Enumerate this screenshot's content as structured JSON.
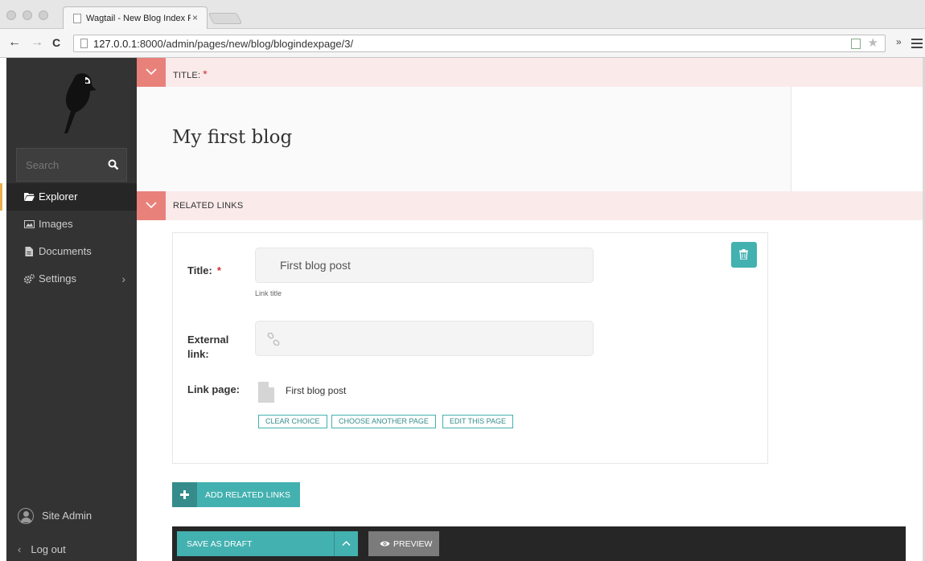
{
  "browser": {
    "tab_title": "Wagtail - New Blog Index P",
    "tab_close": "×",
    "url_host": "127.0.0.1",
    "url_rest": ":8000/admin/pages/new/blog/blogindexpage/3/",
    "back": "←",
    "forward": "→",
    "reload": "C",
    "star": "★",
    "chevrons": "»"
  },
  "sidebar": {
    "search_placeholder": "Search",
    "items": [
      {
        "label": "Explorer",
        "icon": "folder-open-icon",
        "active": true
      },
      {
        "label": "Images",
        "icon": "image-icon"
      },
      {
        "label": "Documents",
        "icon": "document-icon"
      },
      {
        "label": "Settings",
        "icon": "cogs-icon",
        "arrow": "›"
      }
    ],
    "account_name": "Site Admin",
    "logout_chevron": "‹",
    "logout_label": "Log out"
  },
  "form": {
    "title_section": {
      "label": "TITLE:",
      "required": "*",
      "value": "My first blog"
    },
    "related_section": {
      "label": "RELATED LINKS"
    },
    "related_link": {
      "title_label": "Title:",
      "title_required": "*",
      "title_value": "First blog post",
      "title_help": "Link title",
      "external_label_1": "External",
      "external_label_2": "link:",
      "external_value": "",
      "link_page_label": "Link page:",
      "link_page_value": "First blog post",
      "clear_choice": "CLEAR CHOICE",
      "choose_another": "CHOOSE ANOTHER PAGE",
      "edit_page": "EDIT THIS PAGE"
    },
    "add_related": "ADD RELATED LINKS"
  },
  "footer": {
    "save_draft": "SAVE AS DRAFT",
    "preview": "PREVIEW"
  },
  "colors": {
    "teal": "#43b1b0",
    "teal_dark": "#358c8b",
    "sidebar_bg": "#333333",
    "section_header_bg": "#fbeaea",
    "section_toggle": "#e9817b",
    "required": "#cd3238"
  }
}
